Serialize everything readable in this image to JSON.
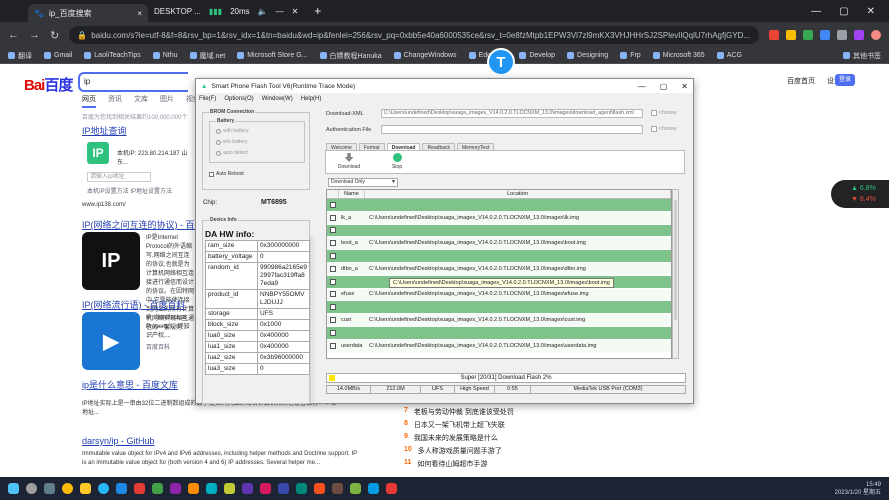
{
  "browser": {
    "tab_title": "ip_百度搜索",
    "tab_label_prefix": "DESKTOP ...",
    "wifi_ms": "20ms",
    "new_tab": "+",
    "url": "baidu.com/s?ie=utf-8&f=8&rsv_bp=1&rsv_idx=1&tn=baidu&wd=ip&fenlei=256&rsv_pq=0xbb5e40a6000535ce&rsv_t=0e8fzMtpb1EPW3Vl7zl9mKX3VHJHHrSJ2SPlevlIQqlU7rhAgfjGYD...",
    "bookmarks": [
      "翻译",
      "Gmail",
      "LaoliTeachTips",
      "Nthu",
      "魔域.net",
      "Microsoft Store G...",
      "白嫖教程Hanuka",
      "ChangeWindows",
      "Edgeless",
      "Develop",
      "Designing",
      "Frp",
      "Microsoft 365",
      "ACG",
      "其他书签"
    ]
  },
  "baidu": {
    "logo_text": "Bai",
    "logo_text2": "百度",
    "search_value": "ip",
    "top_links": [
      "百度首页",
      "设置"
    ],
    "login": "登录",
    "tabs": [
      "网页",
      "资讯",
      "文库",
      "图片",
      "视频"
    ],
    "result_count": "百度为您找到相关结果约100,000,000个",
    "results": [
      {
        "title": "IP地址查询",
        "text": "本机IP: 223.80.214.187  山东..."
      },
      {
        "title": "IP(网络之间互连的协议) - 百度百科",
        "text": "IP是Internet Protocol的外语缩写,网络之间互连的协议,也就是为计算机网络相互连接进行通信而设计的协议。在因特网中,它是能使连接到网上的所有计算机网络实现相互通信的一套规则..."
      },
      {
        "title": "IP(网络流行语) - 百度百科",
        "text": "IP（Intellectual Property），即知识产权,..."
      },
      {
        "title": "ip是什么意思 - 百度文库",
        "text": "IP地址实际上是一串由32位二进制数组成的数字,是因特网上的每台计算机和其他设备都有一个唯一地址..."
      },
      {
        "title": "darsyn/ip - GitHub",
        "text": "Immutable value object for IPv4 and IPv6 addresses, including helper methods and Doctrine support. IP is an immutable value object for (both version 4 and 6) IP addresses. Several helper me..."
      }
    ],
    "ip_input_placeholder": "请输入ip地址",
    "ip_links": "本机IP设置方法   IP地址设置方法",
    "ip_link_url": "www.ip138.com/",
    "baike_label": "百度百科",
    "hot_list": [
      {
        "num": "7",
        "text": "老板与劳动仲裁 到底谁该受处罚"
      },
      {
        "num": "8",
        "text": "日本又一架飞机带上超飞失联"
      },
      {
        "num": "9",
        "text": "我国未来的发展策略是什么"
      },
      {
        "num": "10",
        "text": "多人称游戏质量问题手游了"
      },
      {
        "num": "11",
        "text": "如何看待山姆超市手游"
      }
    ],
    "weather": {
      "up": "▲ 6.8%",
      "down": "▼ 8.4%"
    }
  },
  "flash_tool": {
    "title": "Smart Phone Flash Tool V6(Runtime Trace Mode)",
    "menu": [
      "File(F)",
      "Options(O)",
      "Window(W)",
      "Help(H)"
    ],
    "brom_label": "BROM Connection",
    "battery_label": "Battery",
    "battery_opts": [
      "with battery",
      "w/o battery",
      "auto detect"
    ],
    "auto_reboot": "Auto Reboot",
    "chip_label": "Chip:",
    "chip_value": "MT6895",
    "device_info_label": "Device Info",
    "hw_info_title": "DA HW info:",
    "hw_info": [
      {
        "k": "ram_size",
        "v": "0x300000000"
      },
      {
        "k": "battery_voltage",
        "v": "0"
      },
      {
        "k": "random_id",
        "v": "990986a2165e92997fac319ffa87eda9"
      },
      {
        "k": "product_id",
        "v": "NNBPY55OMVLJDUJJ"
      },
      {
        "k": "storage",
        "v": "UFS"
      },
      {
        "k": "block_size",
        "v": "0x1000"
      },
      {
        "k": "lua0_size",
        "v": "0x400000"
      },
      {
        "k": "lua1_size",
        "v": "0x400000"
      },
      {
        "k": "lua2_size",
        "v": "0x3b96000000"
      },
      {
        "k": "lua3_size",
        "v": "0"
      }
    ],
    "download_xml_label": "Download-XML",
    "download_xml_value": "C:\\Users\\undefined\\Desktop\\xuaga_images_V14.0.2.0.TLOCNXM_13.0\\images\\download_agent\\flash.xml",
    "auth_label": "Authentication File",
    "choose": "choose",
    "tabs": [
      "Welcome",
      "Format",
      "Download",
      "Readback",
      "MemoryTest"
    ],
    "tool_download": "Download",
    "tool_stop": "Stop",
    "mode": "Download Only",
    "col_name": "Name",
    "col_location": "Location",
    "partitions": [
      {
        "name": "",
        "loc": "",
        "g": true
      },
      {
        "name": "lk_a",
        "loc": "C:\\Users\\undefined\\Desktop\\xuaga_images_V14.0.2.0.TLOCNXM_13.0\\images\\lk.img",
        "g": false
      },
      {
        "name": "",
        "loc": "",
        "g": true
      },
      {
        "name": "boot_a",
        "loc": "C:\\Users\\undefined\\Desktop\\xuaga_images_V14.0.2.0.TLOCNXM_13.0\\images\\boot.img",
        "g": false
      },
      {
        "name": "",
        "loc": "",
        "g": true
      },
      {
        "name": "dtbo_a",
        "loc": "C:\\Users\\undefined\\Desktop\\xuaga_images_V14.0.2.0.TLOCNXM_13.0\\images\\dtbo.img",
        "g": false
      },
      {
        "name": "",
        "loc": "",
        "g": true
      },
      {
        "name": "efuse",
        "loc": "C:\\Users\\undefined\\Desktop\\xuaga_images_V14.0.2.0.TLOCNXM_13.0\\images\\efuse.img",
        "g": false
      },
      {
        "name": "",
        "loc": "",
        "g": true
      },
      {
        "name": "cust",
        "loc": "C:\\Users\\undefined\\Desktop\\xuaga_images_V14.0.2.0.TLOCNXM_13.0\\images\\cust.img",
        "g": false
      },
      {
        "name": "",
        "loc": "",
        "g": true
      },
      {
        "name": "userdata",
        "loc": "C:\\Users\\undefined\\Desktop\\xuaga_images_V14.0.2.0.TLOCNXM_13.0\\images\\userdata.img",
        "g": false
      }
    ],
    "tooltip": "C:\\Users\\undefined\\Desktop\\xuaga_images_V14.0.2.0.TLOCNXM_13.0\\images\\boot.img",
    "progress_text": "Super [20/31] Download Flash 2%",
    "status": [
      "14.0MB/s",
      "212.0M",
      "UFS",
      "High Speed",
      "0:55",
      "MediaTek USB Port (COM3)"
    ]
  },
  "taskbar": {
    "clock": "2023/1/20 星期五",
    "time": "15:49"
  }
}
